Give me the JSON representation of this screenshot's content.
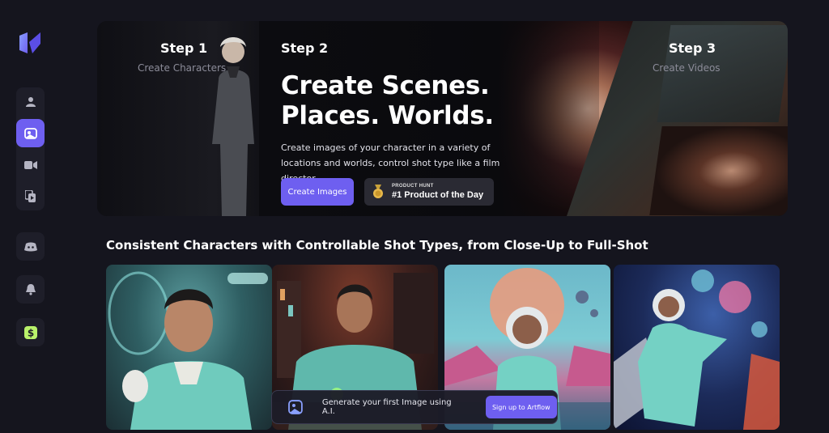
{
  "sidebar": {
    "logo": "artflow-logo",
    "items": [
      {
        "icon": "user-icon"
      },
      {
        "icon": "scene-icon",
        "active": true
      },
      {
        "icon": "video-camera-icon"
      },
      {
        "icon": "copy-play-icon"
      }
    ],
    "extras": [
      {
        "icon": "discord-icon"
      },
      {
        "icon": "bell-icon"
      },
      {
        "icon": "dollar-icon"
      }
    ]
  },
  "hero": {
    "step1": {
      "label": "Step 1",
      "subtitle": "Create Characters"
    },
    "step2": {
      "label": "Step 2"
    },
    "step3": {
      "label": "Step 3",
      "subtitle": "Create Videos"
    },
    "title_line1": "Create Scenes.",
    "title_line2": "Places. Worlds.",
    "description": "Create images of your character in a variety of locations and worlds, control shot type like a film director.",
    "cta_label": "Create Images",
    "badge": {
      "line1": "PRODUCT HUNT",
      "line2": "#1 Product of the Day"
    }
  },
  "gallery": {
    "title": "Consistent Characters with Controllable Shot Types, from Close-Up to Full-Shot"
  },
  "toast": {
    "message": "Generate your first Image using A.I.",
    "button_label": "Sign up to Artflow"
  },
  "colors": {
    "accent": "#6e5ff0",
    "background": "#15151e",
    "suit": "#6fcbbd"
  }
}
